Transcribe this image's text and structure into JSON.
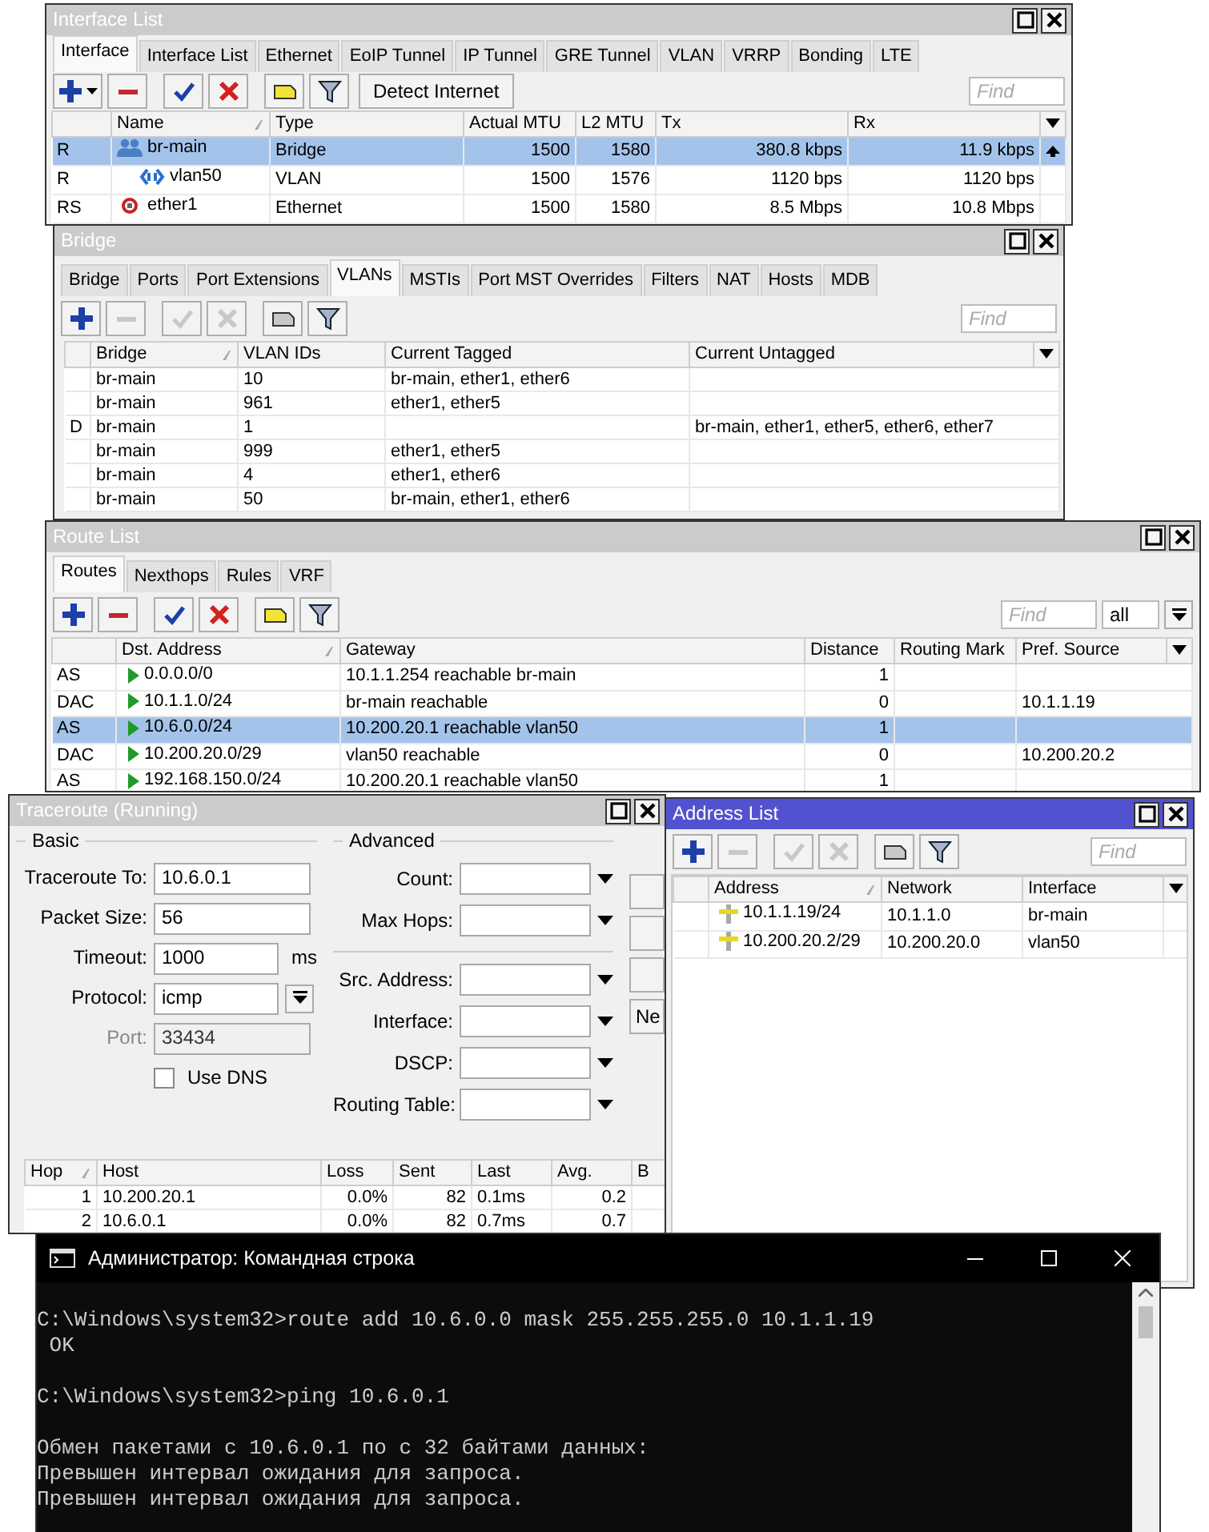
{
  "interface_window": {
    "title": "Interface List",
    "tabs": [
      {
        "label": "Interface",
        "selected": true
      },
      {
        "label": "Interface List",
        "selected": false
      },
      {
        "label": "Ethernet",
        "selected": false
      },
      {
        "label": "EoIP Tunnel",
        "selected": false
      },
      {
        "label": "IP Tunnel",
        "selected": false
      },
      {
        "label": "GRE Tunnel",
        "selected": false
      },
      {
        "label": "VLAN",
        "selected": false
      },
      {
        "label": "VRRP",
        "selected": false
      },
      {
        "label": "Bonding",
        "selected": false
      },
      {
        "label": "LTE",
        "selected": false
      }
    ],
    "toolbar": [
      {
        "kind": "add-menu",
        "disabled": false
      },
      {
        "kind": "remove",
        "disabled": false
      },
      {
        "kind": "enable",
        "disabled": false
      },
      {
        "kind": "disable",
        "disabled": false
      },
      {
        "kind": "comment",
        "disabled": false
      },
      {
        "kind": "filter",
        "disabled": false
      }
    ],
    "detect_button": "Detect Internet",
    "find_placeholder": "Find",
    "columns": [
      "Name",
      "Type",
      "Actual MTU",
      "L2 MTU",
      "Tx",
      "Rx"
    ],
    "rows": [
      {
        "flags": "R",
        "kind": "bridge",
        "name": "br-main",
        "type": "Bridge",
        "actual_mtu": "1500",
        "l2_mtu": "1580",
        "tx": "380.8 kbps",
        "rx": "11.9 kbps",
        "selected": true,
        "children": [
          {
            "flags": "R",
            "kind": "vlan",
            "name": "vlan50",
            "type": "VLAN",
            "actual_mtu": "1500",
            "l2_mtu": "1576",
            "tx": "1120 bps",
            "rx": "1120 bps",
            "selected": false
          }
        ]
      },
      {
        "flags": "RS",
        "kind": "ethernet",
        "name": "ether1",
        "type": "Ethernet",
        "actual_mtu": "1500",
        "l2_mtu": "1580",
        "tx": "8.5 Mbps",
        "rx": "10.8 Mbps",
        "selected": false
      }
    ]
  },
  "bridge_window": {
    "title": "Bridge",
    "tabs": [
      {
        "label": "Bridge",
        "selected": false
      },
      {
        "label": "Ports",
        "selected": false
      },
      {
        "label": "Port Extensions",
        "selected": false
      },
      {
        "label": "VLANs",
        "selected": true
      },
      {
        "label": "MSTIs",
        "selected": false
      },
      {
        "label": "Port MST Overrides",
        "selected": false
      },
      {
        "label": "Filters",
        "selected": false
      },
      {
        "label": "NAT",
        "selected": false
      },
      {
        "label": "Hosts",
        "selected": false
      },
      {
        "label": "MDB",
        "selected": false
      }
    ],
    "toolbar": [
      {
        "kind": "add",
        "disabled": false
      },
      {
        "kind": "remove",
        "disabled": true
      },
      {
        "kind": "enable",
        "disabled": true
      },
      {
        "kind": "disable",
        "disabled": true
      },
      {
        "kind": "comment",
        "disabled": true
      },
      {
        "kind": "filter",
        "disabled": false
      }
    ],
    "find_placeholder": "Find",
    "columns": [
      "Bridge",
      "VLAN IDs",
      "Current Tagged",
      "Current Untagged"
    ],
    "rows": [
      {
        "bridge": "br-main",
        "vlan_ids": "10",
        "current_tagged": "br-main, ether1, ether6",
        "selected": false
      },
      {
        "bridge": "br-main",
        "vlan_ids": "961",
        "current_tagged": "ether1, ether5",
        "selected": false
      },
      {
        "flags": "D",
        "bridge": "br-main",
        "vlan_ids": "1",
        "current_untagged": "br-main, ether1, ether5, ether6, ether7",
        "selected": false
      },
      {
        "bridge": "br-main",
        "vlan_ids": "999",
        "current_tagged": "ether1, ether5",
        "selected": false
      },
      {
        "bridge": "br-main",
        "vlan_ids": "4",
        "current_tagged": "ether1, ether6",
        "selected": false
      },
      {
        "bridge": "br-main",
        "vlan_ids": "50",
        "current_tagged": "br-main, ether1, ether6",
        "selected": false
      }
    ]
  },
  "route_window": {
    "title": "Route List",
    "tabs": [
      {
        "label": "Routes",
        "selected": true
      },
      {
        "label": "Nexthops",
        "selected": false
      },
      {
        "label": "Rules",
        "selected": false
      },
      {
        "label": "VRF",
        "selected": false
      }
    ],
    "toolbar": [
      {
        "kind": "add",
        "disabled": false
      },
      {
        "kind": "remove",
        "disabled": false
      },
      {
        "kind": "enable",
        "disabled": false
      },
      {
        "kind": "disable",
        "disabled": false
      },
      {
        "kind": "comment",
        "disabled": false
      },
      {
        "kind": "filter",
        "disabled": false
      }
    ],
    "find_placeholder": "Find",
    "scope_select": "all",
    "columns": [
      "Dst. Address",
      "Gateway",
      "Distance",
      "Routing Mark",
      "Pref. Source"
    ],
    "rows": [
      {
        "flags": "AS",
        "dst": "0.0.0.0/0",
        "gateway": "10.1.1.254 reachable br-main",
        "distance": "1",
        "selected": false
      },
      {
        "flags": "DAC",
        "dst": "10.1.1.0/24",
        "gateway": "br-main reachable",
        "distance": "0",
        "pref_source": "10.1.1.19",
        "selected": false
      },
      {
        "flags": "AS",
        "dst": "10.6.0.0/24",
        "gateway": "10.200.20.1 reachable vlan50",
        "distance": "1",
        "selected": true
      },
      {
        "flags": "DAC",
        "dst": "10.200.20.0/29",
        "gateway": "vlan50 reachable",
        "distance": "0",
        "pref_source": "10.200.20.2",
        "selected": false
      },
      {
        "flags": "AS",
        "dst": "192.168.150.0/24",
        "gateway": "10.200.20.1 reachable vlan50",
        "distance": "1",
        "selected": false
      }
    ]
  },
  "traceroute_window": {
    "title": "Traceroute (Running)",
    "basic_legend": "Basic",
    "advanced_legend": "Advanced",
    "basic_fields": [
      {
        "label": "Traceroute To:",
        "value": "10.6.0.1",
        "kind": "text",
        "disabled": false
      },
      {
        "label": "Packet Size:",
        "value": "56",
        "kind": "text",
        "disabled": false
      },
      {
        "label": "Timeout:",
        "value": "1000",
        "kind": "unit",
        "unit": "ms",
        "disabled": false
      },
      {
        "label": "Protocol:",
        "value": "icmp",
        "kind": "select",
        "disabled": false
      },
      {
        "label": "Port:",
        "value": "33434",
        "kind": "text",
        "disabled": true
      }
    ],
    "use_dns": {
      "label": "Use DNS",
      "checked": false
    },
    "advanced_fields": [
      [
        "Count:",
        "Max Hops:"
      ],
      [
        "Src. Address:",
        "Interface:",
        "DSCP:",
        "Routing Table:"
      ]
    ],
    "side_button": "Ne",
    "columns": [
      "Hop",
      "Host",
      "Loss",
      "Sent",
      "Last",
      "Avg.",
      "B"
    ],
    "rows": [
      {
        "hop": "1",
        "host": "10.200.20.1",
        "loss": "0.0%",
        "sent": "82",
        "last": "0.1ms",
        "avg": "0.2",
        "selected": false
      },
      {
        "hop": "2",
        "host": "10.6.0.1",
        "loss": "0.0%",
        "sent": "82",
        "last": "0.7ms",
        "avg": "0.7",
        "selected": false
      }
    ]
  },
  "address_window": {
    "title": "Address List",
    "active": true,
    "toolbar": [
      {
        "kind": "add",
        "disabled": false
      },
      {
        "kind": "remove",
        "disabled": true
      },
      {
        "kind": "enable",
        "disabled": true
      },
      {
        "kind": "disable",
        "disabled": true
      },
      {
        "kind": "comment",
        "disabled": true
      },
      {
        "kind": "filter",
        "disabled": false
      }
    ],
    "find_placeholder": "Find",
    "columns": [
      "Address",
      "Network",
      "Interface"
    ],
    "rows": [
      {
        "address": "10.1.1.19/24",
        "network": "10.1.1.0",
        "interface": "br-main",
        "selected": false
      },
      {
        "address": "10.200.20.2/29",
        "network": "10.200.20.0",
        "interface": "vlan50",
        "selected": false
      }
    ]
  },
  "cmd_window": {
    "title": "Администратор: Командная строка",
    "blocks": [
      [
        "C:\\Windows\\system32>route add 10.6.0.0 mask 255.255.255.0 10.1.1.19",
        " OK"
      ],
      [
        "C:\\Windows\\system32>ping 10.6.0.1"
      ],
      [
        "Обмен пакетами с 10.6.0.1 по с 32 байтами данных:",
        "Превышен интервал ожидания для запроса.",
        "Превышен интервал ожидания для запроса."
      ]
    ]
  }
}
